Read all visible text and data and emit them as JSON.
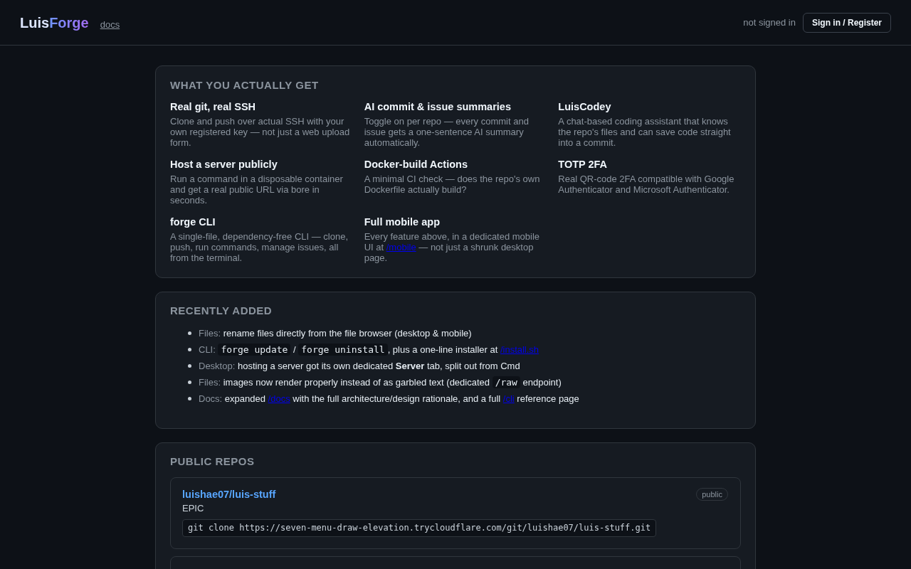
{
  "header": {
    "brand": {
      "text": "Luis",
      "accent": "Forge"
    },
    "docs_link": "docs",
    "auth_status": "not signed in",
    "sign_in_button": "Sign in / Register"
  },
  "features": {
    "title": "WHAT YOU ACTUALLY GET",
    "items": [
      {
        "title": "Real git, real SSH",
        "description": [
          {
            "kind": "text",
            "text": "Clone and push over actual SSH with your own registered key — not just a web upload form."
          }
        ]
      },
      {
        "title": "AI commit & issue summaries",
        "description": [
          {
            "kind": "text",
            "text": "Toggle on per repo — every commit and issue gets a one-sentence AI summary automatically."
          }
        ]
      },
      {
        "title": "LuisCodey",
        "description": [
          {
            "kind": "text",
            "text": "A chat-based coding assistant that knows the repo's files and can save code straight into a commit."
          }
        ]
      },
      {
        "title": "Host a server publicly",
        "description": [
          {
            "kind": "text",
            "text": "Run a command in a disposable container and get a real public URL via bore in seconds."
          }
        ]
      },
      {
        "title": "Docker-build Actions",
        "description": [
          {
            "kind": "text",
            "text": "A minimal CI check — does the repo's own Dockerfile actually build?"
          }
        ]
      },
      {
        "title": "TOTP 2FA",
        "description": [
          {
            "kind": "text",
            "text": "Real QR-code 2FA compatible with Google Authenticator and Microsoft Authenticator."
          }
        ]
      },
      {
        "title": "forge CLI",
        "description": [
          {
            "kind": "text",
            "text": "A single-file, dependency-free CLI — clone, push, run commands, manage issues, all from the terminal."
          }
        ]
      },
      {
        "title": "Full mobile app",
        "description": [
          {
            "kind": "text",
            "text": "Every feature above, in a dedicated mobile UI at "
          },
          {
            "kind": "link",
            "text": "/mobile"
          },
          {
            "kind": "text",
            "text": " — not just a shrunk desktop page."
          }
        ]
      }
    ]
  },
  "recently_added": {
    "title": "RECENTLY ADDED",
    "items": [
      {
        "label": "Files:",
        "segments": [
          {
            "kind": "text",
            "text": "rename files directly from the file browser (desktop & mobile)"
          }
        ]
      },
      {
        "label": "CLI:",
        "segments": [
          {
            "kind": "code",
            "text": "forge update"
          },
          {
            "kind": "text",
            "text": " / "
          },
          {
            "kind": "code",
            "text": "forge uninstall"
          },
          {
            "kind": "text",
            "text": ", plus a one-line installer at "
          },
          {
            "kind": "link",
            "text": "/install.sh"
          }
        ]
      },
      {
        "label": "Desktop:",
        "segments": [
          {
            "kind": "text",
            "text": "hosting a server got its own dedicated **Server** tab, split out from Cmd"
          }
        ]
      },
      {
        "label": "Files:",
        "segments": [
          {
            "kind": "text",
            "text": "images now render properly instead of as garbled text (dedicated "
          },
          {
            "kind": "code",
            "text": "/raw"
          },
          {
            "kind": "text",
            "text": " endpoint)"
          }
        ]
      },
      {
        "label": "Docs:",
        "segments": [
          {
            "kind": "text",
            "text": "expanded "
          },
          {
            "kind": "link",
            "text": "/docs"
          },
          {
            "kind": "text",
            "text": " with the full architecture/design rationale, and a full "
          },
          {
            "kind": "link",
            "text": "/cli"
          },
          {
            "kind": "text",
            "text": " reference page"
          }
        ]
      }
    ]
  },
  "public_repos": {
    "title": "PUBLIC REPOS",
    "repos": [
      {
        "name": "luishae07/luis-stuff",
        "visibility": "public",
        "description": "EPIC",
        "clone_command": "git clone https://seven-menu-draw-elevation.trycloudflare.com/git/luishae07/luis-stuff.git"
      }
    ]
  }
}
